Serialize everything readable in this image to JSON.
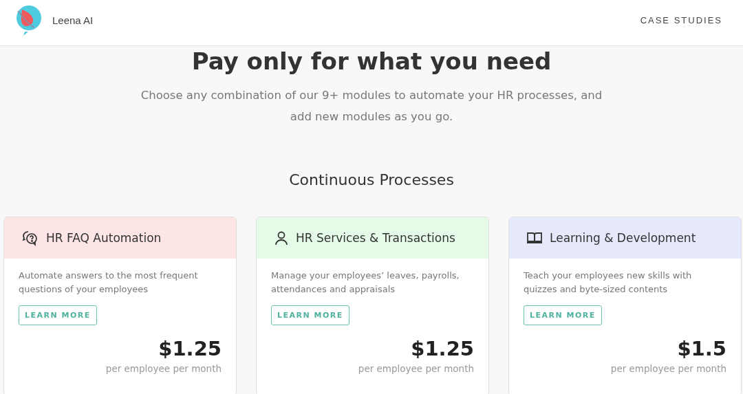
{
  "header": {
    "brand": "Leena AI",
    "nav": [
      "CASE STUDIES"
    ]
  },
  "hero": {
    "title": "Pay only for what you need",
    "subtitle": "Choose any combination of our 9+ modules to automate your HR processes, and add new modules as you go."
  },
  "section": {
    "title": "Continuous Processes",
    "cards": [
      {
        "title": "HR FAQ Automation",
        "color": "#fde4e5",
        "description": "Automate answers to the most frequent questions of your employees",
        "button": "LEARN MORE",
        "price": "$1.25",
        "unit": "per employee per month"
      },
      {
        "title": "HR Services & Transactions",
        "color": "#e5fbe7",
        "description": "Manage your employees’ leaves, payrolls, attendances and appraisals",
        "button": "LEARN MORE",
        "price": "$1.25",
        "unit": "per employee per month"
      },
      {
        "title": "Learning & Development",
        "color": "#e6e8fb",
        "description": "Teach your employees new skills with quizzes and byte-sized contents",
        "button": "LEARN MORE",
        "price": "$1.5",
        "unit": "per employee per month"
      }
    ]
  }
}
